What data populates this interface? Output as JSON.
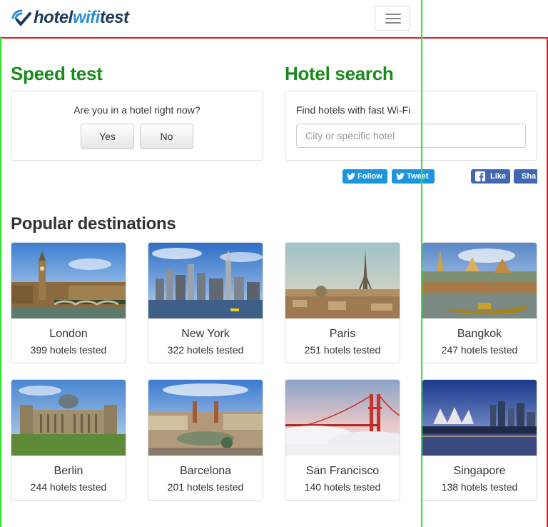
{
  "header": {
    "logo": {
      "part1": "hotel",
      "part2": "wifi",
      "part3": "test"
    },
    "menu_icon": "hamburger-icon"
  },
  "speed_test": {
    "title": "Speed test",
    "question": "Are you in a hotel right now?",
    "yes_label": "Yes",
    "no_label": "No"
  },
  "hotel_search": {
    "title": "Hotel search",
    "label": "Find hotels with fast Wi-Fi",
    "placeholder": "City or specific hotel"
  },
  "social": {
    "follow": "Follow",
    "tweet": "Tweet",
    "like": "Like",
    "share": "Sha"
  },
  "destinations": {
    "title": "Popular destinations",
    "items": [
      {
        "city": "London",
        "count": "399 hotels tested"
      },
      {
        "city": "New York",
        "count": "322 hotels tested"
      },
      {
        "city": "Paris",
        "count": "251 hotels tested"
      },
      {
        "city": "Bangkok",
        "count": "247 hotels tested"
      },
      {
        "city": "Berlin",
        "count": "244 hotels tested"
      },
      {
        "city": "Barcelona",
        "count": "201 hotels tested"
      },
      {
        "city": "San Francisco",
        "count": "140 hotels tested"
      },
      {
        "city": "Singapore",
        "count": "138 hotels tested"
      }
    ]
  },
  "colors": {
    "heading_green": "#1a8a1a",
    "twitter": "#1b95e0",
    "facebook": "#4267b2",
    "logo_blue": "#2d8fd5",
    "logo_dark": "#1d3b58"
  }
}
